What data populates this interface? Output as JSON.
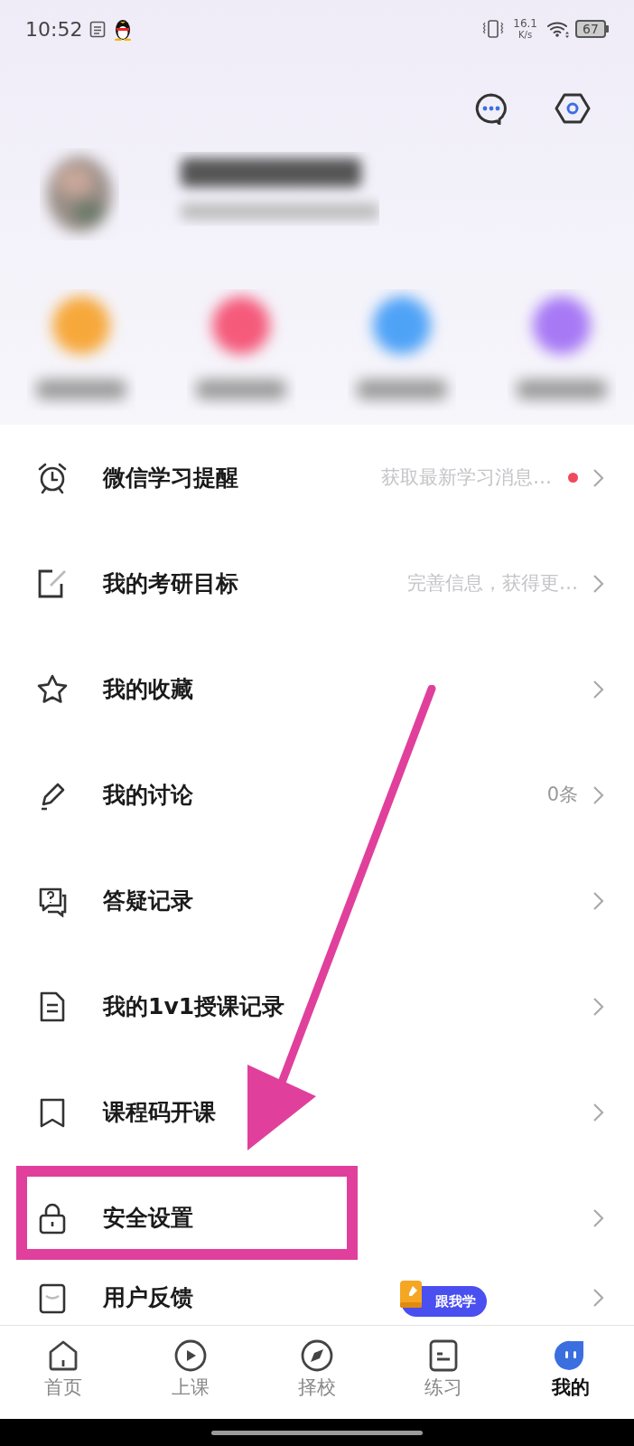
{
  "status_bar": {
    "time": "10:52",
    "speed": "16.1",
    "speed_unit": "K/s",
    "battery": "67"
  },
  "menu": [
    {
      "label": "微信学习提醒",
      "hint": "获取最新学习消息…",
      "dot": true
    },
    {
      "label": "我的考研目标",
      "hint": "完善信息，获得更…",
      "dot": false
    },
    {
      "label": "我的收藏",
      "dot": false
    },
    {
      "label": "我的讨论",
      "count": "0条",
      "dot": false
    },
    {
      "label": "答疑记录",
      "dot": false
    },
    {
      "label": "我的1v1授课记录",
      "dot": false
    },
    {
      "label": "课程码开课",
      "dot": false
    },
    {
      "label": "安全设置",
      "dot": false
    },
    {
      "label": "用户反馈",
      "dot": false
    }
  ],
  "follow_badge": "跟我学",
  "tabs": [
    {
      "label": "首页",
      "selected": false
    },
    {
      "label": "上课",
      "selected": false
    },
    {
      "label": "择校",
      "selected": false
    },
    {
      "label": "练习",
      "selected": false
    },
    {
      "label": "我的",
      "selected": true
    }
  ]
}
